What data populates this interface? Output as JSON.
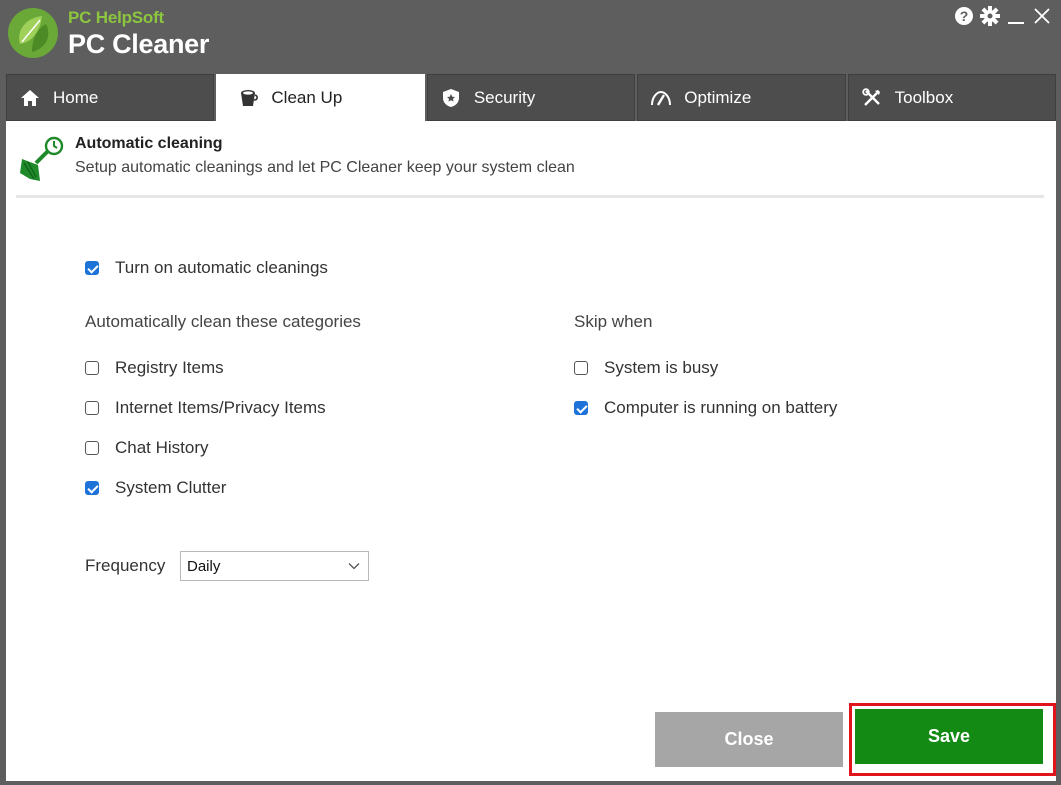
{
  "app": {
    "brand_top": "PC HelpSoft",
    "brand_main": "PC Cleaner",
    "accent_color": "#8cc63f",
    "window_controls": [
      "help-icon",
      "gear-icon",
      "minimize-icon",
      "close-icon"
    ]
  },
  "tabs": [
    {
      "label": "Home",
      "icon": "home-icon",
      "active": false
    },
    {
      "label": "Clean Up",
      "icon": "bucket-icon",
      "active": true
    },
    {
      "label": "Security",
      "icon": "shield-icon",
      "active": false
    },
    {
      "label": "Optimize",
      "icon": "speedometer-icon",
      "active": false
    },
    {
      "label": "Toolbox",
      "icon": "tools-icon",
      "active": false
    }
  ],
  "header": {
    "icon": "broom-clock-icon",
    "title": "Automatic cleaning",
    "subtitle": "Setup automatic cleanings and let PC Cleaner keep your system clean"
  },
  "auto_toggle": {
    "label": "Turn on automatic cleanings",
    "checked": true
  },
  "categories": {
    "label": "Automatically clean these categories",
    "items": [
      {
        "label": "Registry Items",
        "checked": false
      },
      {
        "label": "Internet Items/Privacy Items",
        "checked": false
      },
      {
        "label": "Chat History",
        "checked": false
      },
      {
        "label": "System Clutter",
        "checked": true
      }
    ]
  },
  "skip": {
    "label": "Skip when",
    "items": [
      {
        "label": "System is busy",
        "checked": false
      },
      {
        "label": "Computer is running on battery",
        "checked": true
      }
    ]
  },
  "frequency": {
    "label": "Frequency",
    "value": "Daily"
  },
  "buttons": {
    "close": "Close",
    "save": "Save"
  },
  "colors": {
    "checkbox_checked": "#1e73d8",
    "save": "#138a13",
    "close": "#a6a6a6",
    "highlight": "#e0141b"
  }
}
